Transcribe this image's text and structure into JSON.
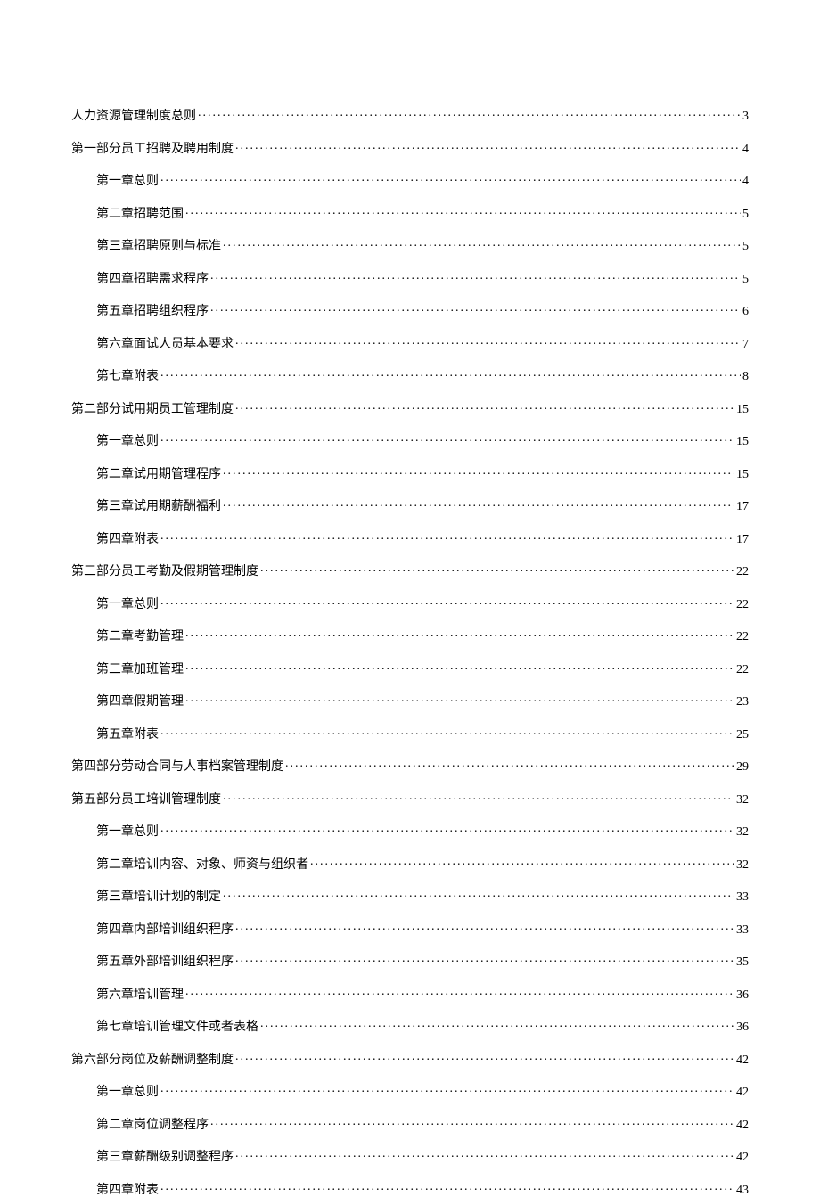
{
  "toc": [
    {
      "level": 0,
      "title": "人力资源管理制度总则",
      "page": "3"
    },
    {
      "level": 0,
      "title": "第一部分员工招聘及聘用制度",
      "page": "4"
    },
    {
      "level": 1,
      "title": "第一章总则",
      "page": "4"
    },
    {
      "level": 1,
      "title": "第二章招聘范围",
      "page": "5"
    },
    {
      "level": 1,
      "title": "第三章招聘原则与标准",
      "page": "5"
    },
    {
      "level": 1,
      "title": "第四章招聘需求程序",
      "page": "5"
    },
    {
      "level": 1,
      "title": "第五章招聘组织程序",
      "page": "6"
    },
    {
      "level": 1,
      "title": "第六章面试人员基本要求",
      "page": "7"
    },
    {
      "level": 1,
      "title": "第七章附表",
      "page": "8"
    },
    {
      "level": 0,
      "title": "第二部分试用期员工管理制度",
      "page": "15"
    },
    {
      "level": 1,
      "title": "第一章总则",
      "page": "15"
    },
    {
      "level": 1,
      "title": "第二章试用期管理程序",
      "page": "15"
    },
    {
      "level": 1,
      "title": "第三章试用期薪酬福利",
      "page": "17"
    },
    {
      "level": 1,
      "title": "第四章附表",
      "page": "17"
    },
    {
      "level": 0,
      "title": "第三部分员工考勤及假期管理制度",
      "page": "22"
    },
    {
      "level": 1,
      "title": "第一章总则",
      "page": "22"
    },
    {
      "level": 1,
      "title": "第二章考勤管理",
      "page": "22"
    },
    {
      "level": 1,
      "title": "第三章加班管理",
      "page": "22"
    },
    {
      "level": 1,
      "title": "第四章假期管理",
      "page": "23"
    },
    {
      "level": 1,
      "title": "第五章附表",
      "page": "25"
    },
    {
      "level": 0,
      "title": "第四部分劳动合同与人事档案管理制度",
      "page": "29"
    },
    {
      "level": 0,
      "title": "第五部分员工培训管理制度",
      "page": "32"
    },
    {
      "level": 1,
      "title": "第一章总则",
      "page": "32"
    },
    {
      "level": 1,
      "title": "第二章培训内容、对象、师资与组织者",
      "page": "32"
    },
    {
      "level": 1,
      "title": "第三章培训计划的制定",
      "page": "33"
    },
    {
      "level": 1,
      "title": "第四章内部培训组织程序",
      "page": "33"
    },
    {
      "level": 1,
      "title": "第五章外部培训组织程序",
      "page": "35"
    },
    {
      "level": 1,
      "title": "第六章培训管理",
      "page": "36"
    },
    {
      "level": 1,
      "title": "第七章培训管理文件或者表格",
      "page": "36"
    },
    {
      "level": 0,
      "title": "第六部分岗位及薪酬调整制度",
      "page": "42"
    },
    {
      "level": 1,
      "title": "第一章总则",
      "page": "42"
    },
    {
      "level": 1,
      "title": "第二章岗位调整程序",
      "page": "42"
    },
    {
      "level": 1,
      "title": "第三章薪酬级别调整程序",
      "page": "42"
    },
    {
      "level": 1,
      "title": "第四章附表",
      "page": "43"
    }
  ]
}
